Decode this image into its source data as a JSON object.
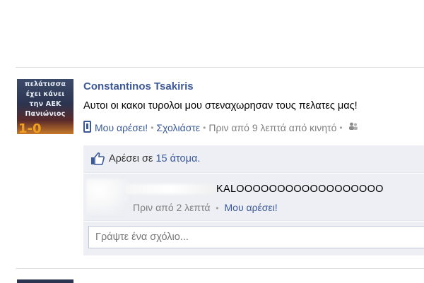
{
  "post": {
    "avatar_lines": [
      "πελάτισσα",
      "έχει κάνει",
      "την ΑΕΚ",
      "Πανιώνιος"
    ],
    "avatar_score": "1-0",
    "author": "Constantinos Tsakiris",
    "message": "Αυτοι οι κακοι τυρολοι μου στεναχωρησαν τους πελατες μας!",
    "like_link": "Μου αρέσει!",
    "comment_link": "Σχολιάστε",
    "timestamp": "Πριν από 9 λεπτά από κινητό"
  },
  "feedback": {
    "likes_prefix": "Αρέσει σε",
    "likes_count_text": "15 άτομα.",
    "comment": {
      "text": "KALOOOOOOOOOOOOOOOOOO",
      "time": "Πριν από 2 λεπτά",
      "like_link": "Μου αρέσει!"
    },
    "write_placeholder": "Γράψτε ένα σχόλιο..."
  },
  "icons": [
    "mobile-icon",
    "people-icon",
    "thumbs-up-icon"
  ],
  "colors": {
    "link": "#3b5998",
    "feedback_bg": "#edeff4",
    "meta_text": "#808080"
  }
}
